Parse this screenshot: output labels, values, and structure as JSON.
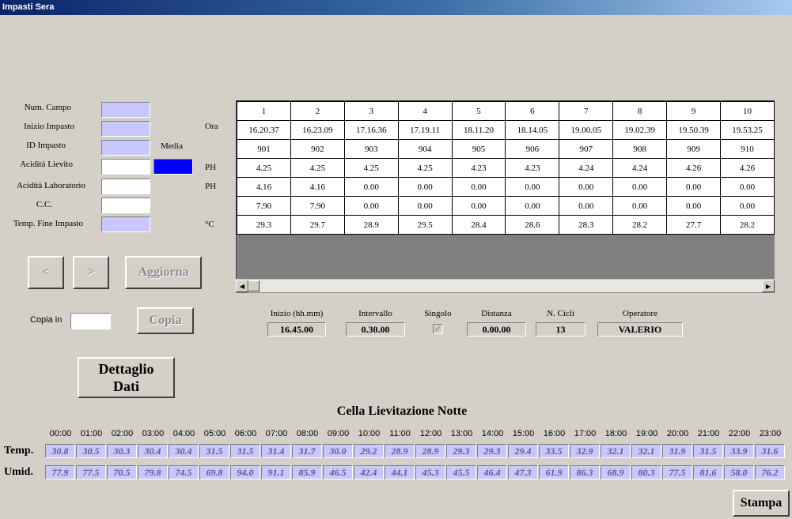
{
  "window": {
    "title": "Impasti Sera"
  },
  "form": {
    "num_campo": "Num. Campo",
    "inizio_impasto": "Inizio Impasto",
    "id_impasto": "ID Impasto",
    "acidita_lievito": "Acidità Lievito",
    "acidita_laboratorio": "Acidità Laboratorio",
    "cc": "C.C.",
    "temp_fine_impasto": "Temp. Fine Impasto",
    "unit_ora": "Ora",
    "media": "Media",
    "unit_ph1": "PH",
    "unit_ph2": "PH",
    "unit_c": "°C",
    "colors": {
      "readonly": "#c8c8ff",
      "media": "#0000ff"
    }
  },
  "grid": {
    "columns": [
      "1",
      "2",
      "3",
      "4",
      "5",
      "6",
      "7",
      "8",
      "9",
      "10"
    ],
    "rows": [
      [
        "16.20.37",
        "16.23.09",
        "17.16.36",
        "17.19.11",
        "18.11.20",
        "18.14.05",
        "19.00.05",
        "19.02.39",
        "19.50.39",
        "19.53.25"
      ],
      [
        "901",
        "902",
        "903",
        "904",
        "905",
        "906",
        "907",
        "908",
        "909",
        "910"
      ],
      [
        "4.25",
        "4.25",
        "4.25",
        "4.25",
        "4.23",
        "4.23",
        "4.24",
        "4.24",
        "4.26",
        "4.26"
      ],
      [
        "4.16",
        "4.16",
        "0.00",
        "0.00",
        "0.00",
        "0.00",
        "0.00",
        "0.00",
        "0.00",
        "0.00"
      ],
      [
        "7.90",
        "7.90",
        "0.00",
        "0.00",
        "0.00",
        "0.00",
        "0.00",
        "0.00",
        "0.00",
        "0.00"
      ],
      [
        "29.3",
        "29.7",
        "28.9",
        "29.5",
        "28.4",
        "28.6",
        "28.3",
        "28.2",
        "27.7",
        "28.2"
      ]
    ]
  },
  "nav": {
    "prev": "<",
    "next": ">",
    "aggiorna": "Aggiorna"
  },
  "copia": {
    "label": "Copia in",
    "value": "",
    "button": "Copia"
  },
  "params": {
    "inizio_label": "Inizio (hh.mm)",
    "inizio_value": "16.45.00",
    "intervallo_label": "Intervallo",
    "intervallo_value": "0.30.00",
    "singolo_label": "Singolo",
    "singolo_checked": true,
    "distanza_label": "Distanza",
    "distanza_value": "0.00.00",
    "ncicli_label": "N. Cicli",
    "ncicli_value": "13",
    "operatore_label": "Operatore",
    "operatore_value": "VALERIO"
  },
  "dettaglio": {
    "line1": "Dettaglio",
    "line2": "Dati"
  },
  "cella": {
    "title": "Cella Lievitazione Notte",
    "temp_label": "Temp.",
    "umid_label": "Umid.",
    "hours": [
      "00:00",
      "01:00",
      "02:00",
      "03:00",
      "04:00",
      "05:00",
      "06:00",
      "07:00",
      "08:00",
      "09:00",
      "10:00",
      "11:00",
      "12:00",
      "13:00",
      "14:00",
      "15:00",
      "16:00",
      "17:00",
      "18:00",
      "19:00",
      "20:00",
      "21:00",
      "22:00",
      "23:00"
    ],
    "temp": [
      "30.8",
      "30.5",
      "30.3",
      "30.4",
      "30.4",
      "31.5",
      "31.5",
      "31.4",
      "31.7",
      "30.0",
      "29.2",
      "28.9",
      "28.9",
      "29.3",
      "29.3",
      "29.4",
      "33.5",
      "32.9",
      "32.1",
      "32.1",
      "31.9",
      "31.5",
      "33.9",
      "31.6"
    ],
    "umid": [
      "77.9",
      "77.5",
      "70.5",
      "79.8",
      "74.5",
      "69.8",
      "94.0",
      "91.1",
      "85.9",
      "46.5",
      "42.4",
      "44.1",
      "45.3",
      "45.5",
      "46.4",
      "47.3",
      "61.9",
      "86.3",
      "68.9",
      "80.3",
      "77.5",
      "81.6",
      "58.0",
      "76.2"
    ]
  },
  "stampa": "Stampa"
}
